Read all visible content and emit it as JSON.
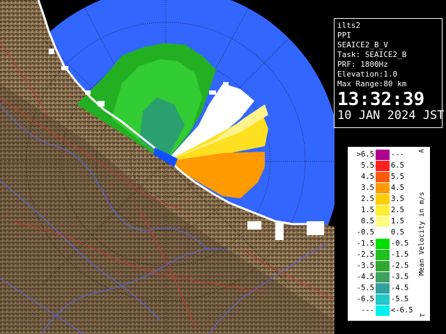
{
  "info": {
    "station": "ilts2",
    "scan_type": "PPI",
    "product": "SEAICE2_B_V",
    "task": "Task: SEAICE2_B",
    "prf": "PRF: 1800Hz",
    "elevation": "Elevation:1.0",
    "max_range": "Max Range:80 km",
    "time": "13:32:39",
    "date": "10 JAN 2024 JST"
  },
  "legend": {
    "title": "Mean Velocity in m/s",
    "corner_top": "A",
    "corner_bottom": "T",
    "rows": [
      {
        "lo": ">6.5",
        "hi": "---",
        "color": "#b00090"
      },
      {
        "lo": "5.5",
        "hi": "6.5",
        "color": "#ff2020"
      },
      {
        "lo": "4.5",
        "hi": "5.5",
        "color": "#ff5a10"
      },
      {
        "lo": "3.5",
        "hi": "4.5",
        "color": "#ff9a00"
      },
      {
        "lo": "2.5",
        "hi": "3.5",
        "color": "#ffcc00"
      },
      {
        "lo": "1.5",
        "hi": "2.5",
        "color": "#ffee30"
      },
      {
        "lo": "0.5",
        "hi": "1.5",
        "color": "#fffa80"
      },
      {
        "lo": "-0.5",
        "hi": "0.5",
        "color": "#ffffff"
      },
      {
        "lo": "-1.5",
        "hi": "-0.5",
        "color": "#00e000"
      },
      {
        "lo": "-2.5",
        "hi": "-1.5",
        "color": "#20c020"
      },
      {
        "lo": "-3.5",
        "hi": "-2.5",
        "color": "#30a830"
      },
      {
        "lo": "-4.5",
        "hi": "-3.5",
        "color": "#40a060"
      },
      {
        "lo": "-5.5",
        "hi": "-4.5",
        "color": "#30a0a0"
      },
      {
        "lo": "-6.5",
        "hi": "-5.5",
        "color": "#20c8c8"
      },
      {
        "lo": "---",
        "hi": "<-6.5",
        "color": "#00f0f0"
      }
    ]
  },
  "colors": {
    "sea": "#3060ff",
    "land": "#7a6448",
    "background": "#000000"
  }
}
